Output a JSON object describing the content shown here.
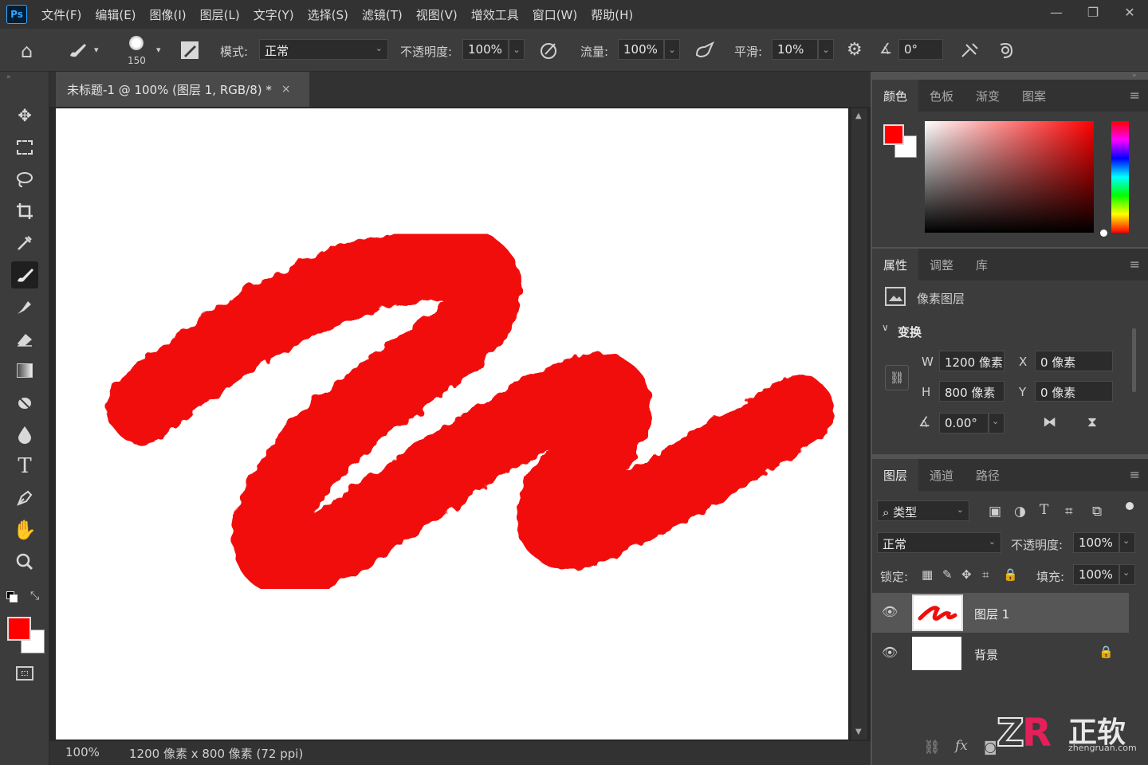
{
  "app": {
    "logo": "Ps"
  },
  "menu": [
    "文件(F)",
    "编辑(E)",
    "图像(I)",
    "图层(L)",
    "文字(Y)",
    "选择(S)",
    "滤镜(T)",
    "视图(V)",
    "增效工具",
    "窗口(W)",
    "帮助(H)"
  ],
  "window_controls": {
    "minimize": "—",
    "restore": "❐",
    "close": "✕"
  },
  "options": {
    "brush_size": "150",
    "mode_label": "模式:",
    "mode_value": "正常",
    "opacity_label": "不透明度:",
    "opacity_value": "100%",
    "flow_label": "流量:",
    "flow_value": "100%",
    "smooth_label": "平滑:",
    "smooth_value": "10%",
    "angle_value": "0°"
  },
  "document": {
    "tab_title": "未标题-1 @ 100% (图层 1, RGB/8) *",
    "close": "×",
    "zoom": "100%",
    "info": "1200 像素 x 800 像素 (72 ppi)"
  },
  "colors": {
    "foreground": "#ff0000",
    "background": "#ffffff",
    "stroke": "#f20d0d"
  },
  "color_panel": {
    "tabs": [
      "颜色",
      "色板",
      "渐变",
      "图案"
    ]
  },
  "properties_panel": {
    "tabs": [
      "属性",
      "调整",
      "库"
    ],
    "layer_type": "像素图层",
    "section": "变换",
    "w_label": "W",
    "w_value": "1200 像素",
    "h_label": "H",
    "h_value": "800 像素",
    "x_label": "X",
    "x_value": "0 像素",
    "y_label": "Y",
    "y_value": "0 像素",
    "angle_value": "0.00°"
  },
  "layers_panel": {
    "tabs": [
      "图层",
      "通道",
      "路径"
    ],
    "filter_value": "类型",
    "blend_value": "正常",
    "opacity_label": "不透明度:",
    "opacity_value": "100%",
    "lock_label": "锁定:",
    "fill_label": "填充:",
    "fill_value": "100%",
    "layers": [
      {
        "name": "图层 1",
        "selected": true
      },
      {
        "name": "背景",
        "locked": true
      }
    ],
    "bottom_icons": [
      "link-icon",
      "fx-icon",
      "mask-icon"
    ]
  },
  "watermark": {
    "brand": "正软",
    "url": "zhengruan.com"
  }
}
